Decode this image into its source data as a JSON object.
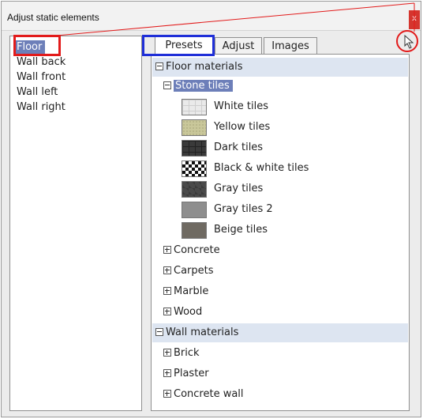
{
  "window": {
    "title": "Adjust static elements",
    "close_label": "x"
  },
  "left_list": {
    "items": [
      "Floor",
      "Wall back",
      "Wall front",
      "Wall left",
      "Wall right"
    ],
    "selected": "Floor"
  },
  "tabs": [
    "Presets",
    "Adjust",
    "Images"
  ],
  "active_tab": "Presets",
  "tree": {
    "floor_group": "Floor materials",
    "stone_node": "Stone tiles",
    "tiles": [
      "White tiles",
      "Yellow tiles",
      "Dark tiles",
      "Black & white tiles",
      "Gray tiles",
      "Gray tiles 2",
      "Beige tiles"
    ],
    "floor_children": [
      "Concrete",
      "Carpets",
      "Marble",
      "Wood"
    ],
    "wall_group": "Wall materials",
    "wall_children": [
      "Brick",
      "Plaster",
      "Concrete wall"
    ]
  },
  "colors": {
    "selection": "#6d7fb9",
    "group_bar": "#dde5f1",
    "annotation_red": "#e21b1b",
    "annotation_blue": "#1f2fd8"
  },
  "icons": [
    "close-icon",
    "cursor-icon",
    "expand-icon",
    "collapse-icon"
  ]
}
